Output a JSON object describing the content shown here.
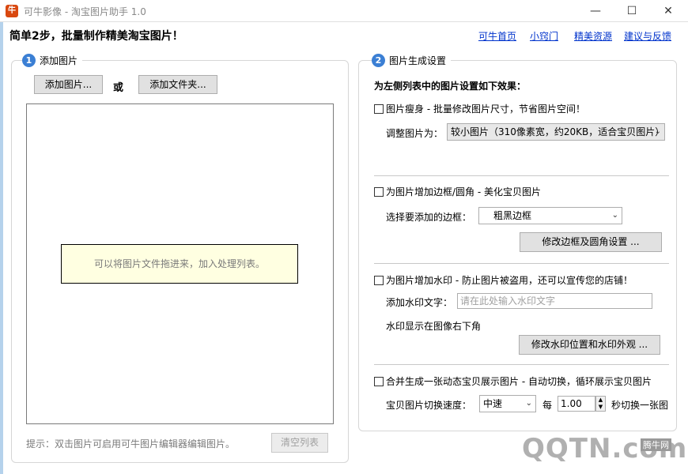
{
  "window": {
    "title": "可牛影像 - 淘宝图片助手 1.0",
    "icon": "app-icon",
    "icon_glyph": "牛"
  },
  "header": {
    "title": "简单2步，批量制作精美淘宝图片！",
    "links": [
      "可牛首页",
      "小窍门",
      "精美资源",
      "建议与反馈"
    ]
  },
  "step1": {
    "number": "1",
    "title": "添加图片",
    "add_images_btn": "添加图片...",
    "or_label": "或",
    "add_folder_btn": "添加文件夹...",
    "drop_hint": "可以将图片文件拖进来，加入处理列表。",
    "footer_hint": "提示：双击图片可启用可牛图片编辑器编辑图片。",
    "clear_btn": "清空列表"
  },
  "step2": {
    "number": "2",
    "title": "图片生成设置",
    "intro": "为左侧列表中的图片设置如下效果：",
    "resize": {
      "checkbox_label": "图片瘦身 - 批量修改图片尺寸，节省图片空间！",
      "size_label": "调整图片为：",
      "size_value": "较小图片（310像素宽，约20KB，适合宝贝图片）"
    },
    "border": {
      "checkbox_label": "为图片增加边框/圆角 - 美化宝贝图片",
      "select_label": "选择要添加的边框：",
      "select_value": "粗黑边框",
      "settings_btn": "修改边框及圆角设置 ..."
    },
    "watermark": {
      "checkbox_label": "为图片增加水印 - 防止图片被盗用，还可以宣传您的店铺！",
      "text_label": "添加水印文字：",
      "text_placeholder": "请在此处输入水印文字",
      "position_note": "水印显示在图像右下角",
      "settings_btn": "修改水印位置和水印外观 ..."
    },
    "animation": {
      "checkbox_label": "合并生成一张动态宝贝展示图片 - 自动切换，循环展示宝贝图片",
      "speed_label": "宝贝图片切换速度：",
      "speed_value": "中速",
      "every_label": "每",
      "seconds_value": "1.00",
      "seconds_suffix": "秒切换一张图"
    }
  },
  "brand_watermark": {
    "logo_text": "QQTN.com",
    "badge_text": "腾牛网"
  },
  "colors": {
    "link": "#0033cc",
    "step_badge": "#3b7fd4",
    "hint_bg": "#ffffe1"
  }
}
